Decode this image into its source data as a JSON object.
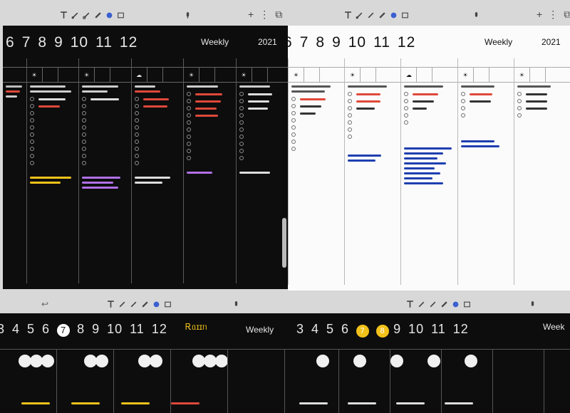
{
  "toolbars": {
    "top_left": {
      "right_icons": [
        "+",
        "⋮",
        "⧉"
      ]
    },
    "top_right": {
      "right_icons": [
        "+",
        "⋮",
        "⧉"
      ]
    },
    "mid_left": {},
    "mid_right": {}
  },
  "planner": {
    "months": [
      "6",
      "7",
      "8",
      "9",
      "10",
      "11",
      "12"
    ],
    "title": "Weekly",
    "year": "2021",
    "bottom_months_left": [
      "3",
      "4",
      "5",
      "6",
      "7",
      "8",
      "9",
      "10",
      "11",
      "12"
    ],
    "bottom_months_right": [
      "3",
      "4",
      "5",
      "6",
      "7",
      "8",
      "9",
      "10",
      "11",
      "12"
    ],
    "bottom_tag": "Ꭱᥲɪɪᥒ",
    "bottom_title_right": "Week"
  },
  "colors": {
    "dark_bg": "#0d0d0d",
    "light_bg": "#fbfbfb",
    "accent_red": "#e0483a",
    "accent_yellow": "#f2c21a",
    "accent_blue": "#1f3fb0",
    "accent_purple": "#b070e6"
  }
}
